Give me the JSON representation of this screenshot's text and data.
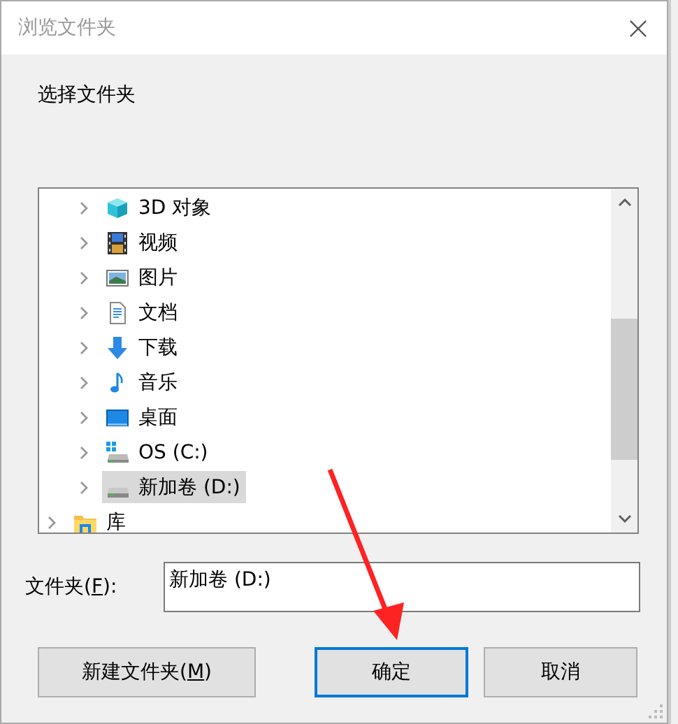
{
  "window": {
    "title": "浏览文件夹"
  },
  "instruction": "选择文件夹",
  "tree": {
    "items": [
      {
        "children": [
          {
            "label": "3D 对象",
            "kind": "cube",
            "selected": false
          },
          {
            "label": "视频",
            "kind": "film",
            "selected": false
          },
          {
            "label": "图片",
            "kind": "image",
            "selected": false
          },
          {
            "label": "文档",
            "kind": "document",
            "selected": false
          },
          {
            "label": "下载",
            "kind": "download",
            "selected": false
          },
          {
            "label": "音乐",
            "kind": "music",
            "selected": false
          },
          {
            "label": "桌面",
            "kind": "desktop",
            "selected": false
          },
          {
            "label": "OS (C:)",
            "kind": "system-drive",
            "selected": false
          },
          {
            "label": "新加卷 (D:)",
            "kind": "drive",
            "selected": true
          }
        ]
      },
      {
        "label": "库",
        "kind": "library",
        "selected": false
      }
    ]
  },
  "folder_field": {
    "label_parts": [
      "文件夹(",
      "F",
      "):"
    ],
    "value": "新加卷 (D:)"
  },
  "buttons": [
    {
      "label_parts": [
        "新建文件夹(",
        "M",
        ")"
      ],
      "default": false
    },
    {
      "label_parts": [
        "确定"
      ],
      "default": true
    },
    {
      "label_parts": [
        "取消"
      ],
      "default": false
    }
  ]
}
